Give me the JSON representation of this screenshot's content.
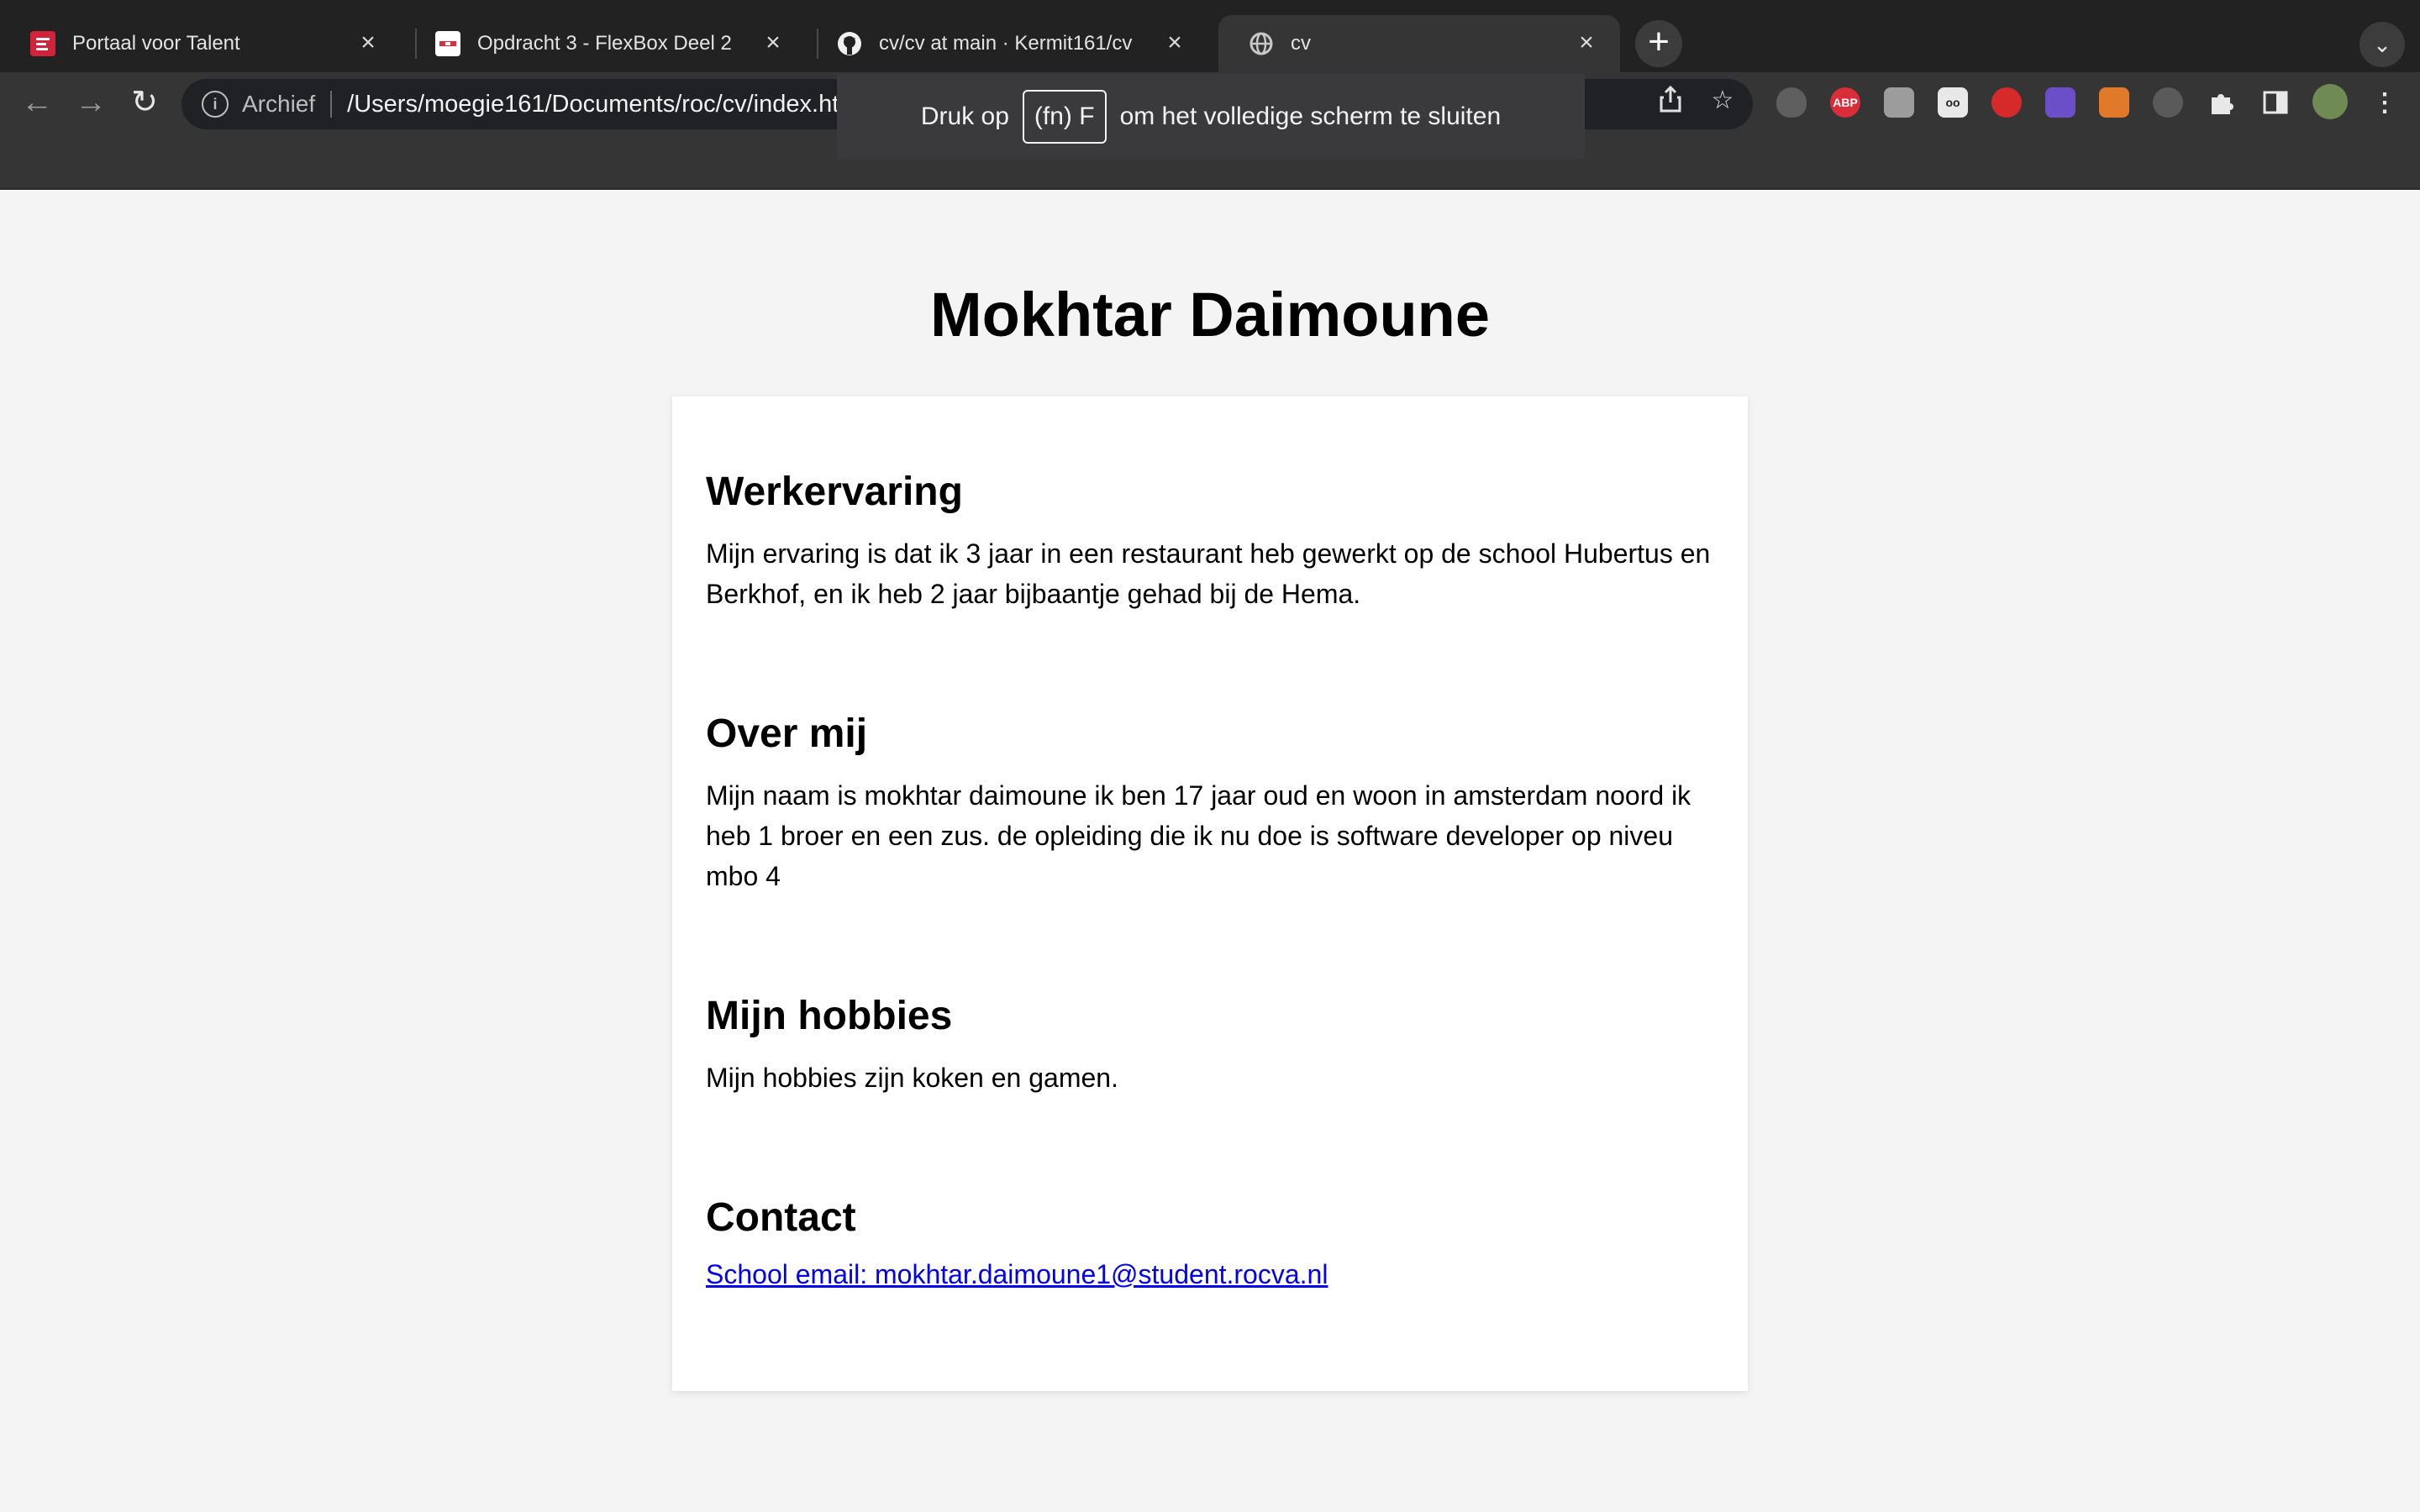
{
  "browser": {
    "tabs": [
      {
        "title": "Portaal voor Talent",
        "favicon": "portaal-icon",
        "active": false
      },
      {
        "title": "Opdracht 3 - FlexBox Deel 2",
        "favicon": "document-icon",
        "active": false
      },
      {
        "title": "cv/cv at main · Kermit161/cv",
        "favicon": "github-icon",
        "active": false
      },
      {
        "title": "cv",
        "favicon": "globe-icon",
        "active": true
      }
    ],
    "omnibox": {
      "security_chip": "Archief",
      "url": "/Users/moegie161/Documents/roc/cv/index.html"
    },
    "extensions": [
      "shield-icon",
      "adblock-icon",
      "extension-icon",
      "glasses-icon",
      "red-extension-icon",
      "tec-icon",
      "save-icon",
      "robot-icon",
      "puzzle-icon",
      "sidepanel-icon",
      "profile-avatar"
    ],
    "extension_labels": {
      "adblock": "ABP"
    },
    "fullscreen_toast": {
      "prefix": "Druk op",
      "key": "(fn) F",
      "suffix": "om het volledige scherm te sluiten"
    },
    "colors": {
      "tabstrip": "#222223",
      "toolbar": "#353535",
      "omnibox": "#202124"
    }
  },
  "page": {
    "title": "Mokhtar Daimoune",
    "sections": [
      {
        "heading": "Werkervaring",
        "text": "Mijn ervaring is dat ik 3 jaar in een restaurant heb gewerkt op de school Hubertus en Berkhof, en ik heb 2 jaar bijbaantje gehad bij de Hema."
      },
      {
        "heading": "Over mij",
        "text": "Mijn naam is mokhtar daimoune ik ben 17 jaar oud en woon in amsterdam noord ik heb 1 broer en een zus. de opleiding die ik nu doe is software developer op niveu mbo 4"
      },
      {
        "heading": "Mijn hobbies",
        "text": "Mijn hobbies zijn koken en gamen."
      },
      {
        "heading": "Contact",
        "link": "School email: mokhtar.daimoune1@student.rocva.nl"
      }
    ],
    "colors": {
      "background": "#f4f4f4",
      "card": "#ffffff",
      "link": "#0000ee"
    }
  }
}
